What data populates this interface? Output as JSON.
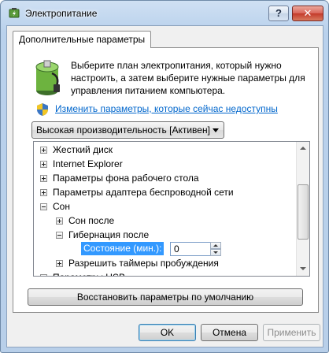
{
  "window": {
    "title": "Электропитание",
    "help_label": "?",
    "close_label": "✕"
  },
  "tab": {
    "label": "Дополнительные параметры"
  },
  "description": "Выберите план электропитания, который нужно настроить, а затем выберите нужные параметры для управления питанием компьютера.",
  "change_link": "Изменить параметры, которые сейчас недоступны",
  "plan_select": {
    "value": "Высокая производительность [Активен]"
  },
  "tree": {
    "items": [
      {
        "label": "Жесткий диск",
        "expander": "plus"
      },
      {
        "label": "Internet Explorer",
        "expander": "plus"
      },
      {
        "label": "Параметры фона рабочего стола",
        "expander": "plus"
      },
      {
        "label": "Параметры адаптера беспроводной сети",
        "expander": "plus"
      },
      {
        "label": "Сон",
        "expander": "minus"
      },
      {
        "label": "Сон после",
        "expander": "plus"
      },
      {
        "label": "Гибернация после",
        "expander": "minus"
      },
      {
        "label": "Состояние (мин.):",
        "input_value": "0"
      },
      {
        "label": "Разрешить таймеры пробуждения",
        "expander": "plus"
      },
      {
        "label": "Параметры USB",
        "expander": "plus"
      }
    ]
  },
  "buttons": {
    "restore": "Восстановить параметры по умолчанию",
    "ok": "OK",
    "cancel": "Отмена",
    "apply": "Применить"
  }
}
